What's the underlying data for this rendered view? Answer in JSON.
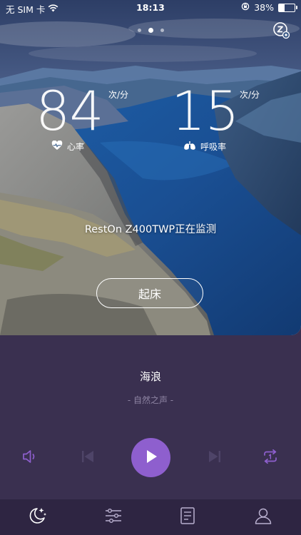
{
  "status_bar": {
    "carrier": "无 SIM 卡",
    "time": "18:13",
    "battery_percent": "38%",
    "battery_level": 0.38
  },
  "pager": {
    "count": 3,
    "active_index": 1
  },
  "heart": {
    "value": "84",
    "unit": "次/分",
    "label": "心率"
  },
  "breath": {
    "value": "15",
    "unit": "次/分",
    "label": "呼吸率"
  },
  "monitor_text": "RestOn Z400TWP正在监测",
  "wake_button_label": "起床",
  "music": {
    "title": "海浪",
    "subtitle": "- 自然之声 -"
  },
  "colors": {
    "accent": "#8e5fce",
    "panel": "#3a3050",
    "tabbar": "#2e2542",
    "inactive": "#4e4468"
  },
  "icons": [
    "sleep-mode-icon",
    "volume-icon",
    "previous-icon",
    "play-icon",
    "next-icon",
    "repeat-one-icon",
    "moon-tab-icon",
    "settings-sliders-icon",
    "report-icon",
    "profile-icon"
  ]
}
